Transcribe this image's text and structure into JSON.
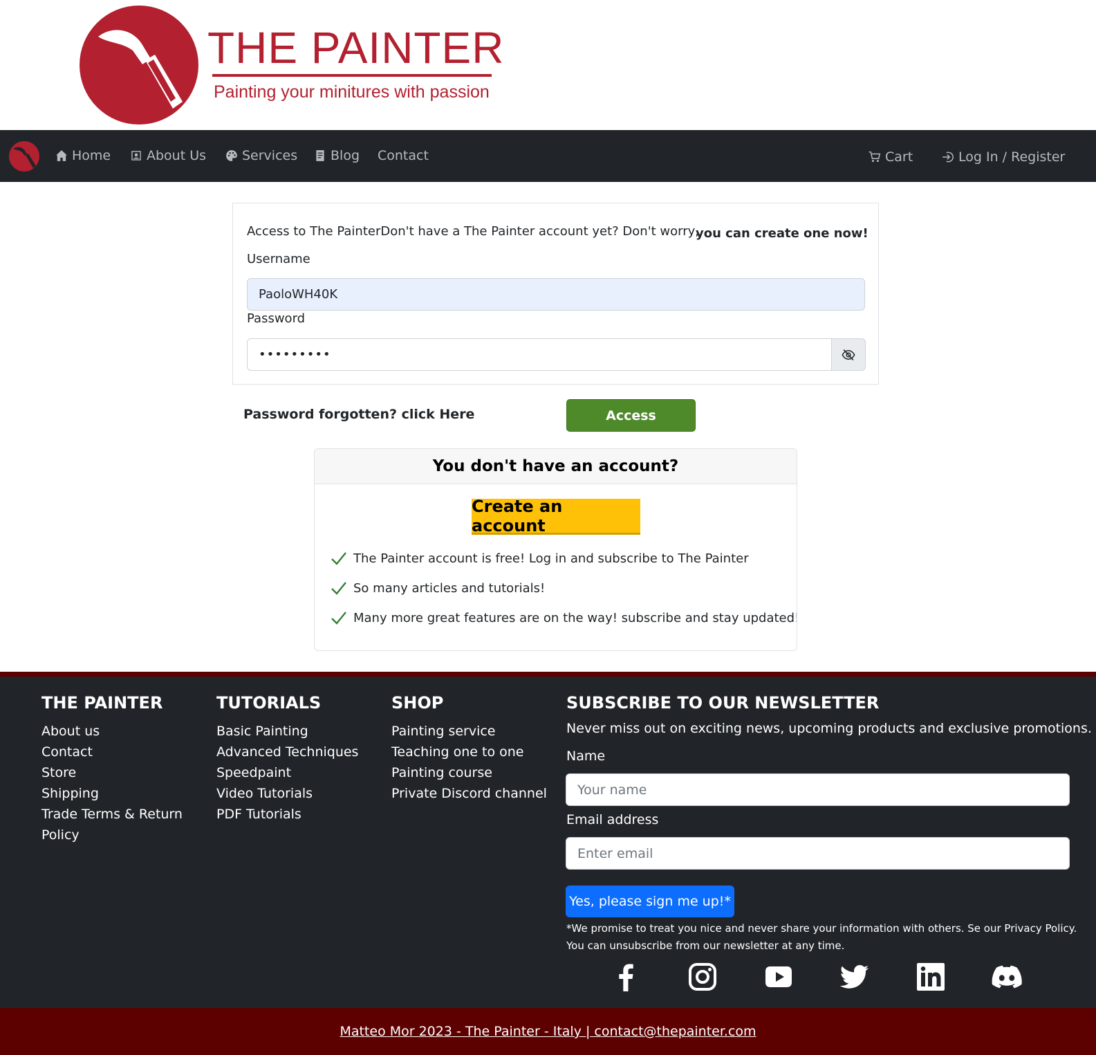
{
  "logo": {
    "title": "THE PAINTER",
    "subtitle": "Painting your minitures with passion",
    "brand_color": "#b3202f"
  },
  "navbar": {
    "items": [
      {
        "label": "Home",
        "icon": "house-icon"
      },
      {
        "label": "About Us",
        "icon": "person-badge-icon"
      },
      {
        "label": "Services",
        "icon": "palette-icon"
      },
      {
        "label": "Blog",
        "icon": "document-icon"
      },
      {
        "label": "Contact",
        "icon": ""
      }
    ],
    "cart_label": "Cart",
    "login_label": "Log In / Register"
  },
  "login": {
    "intro": "Access to The PainterDon't have a The Painter account yet? Don't worry,",
    "create_link": "you can create one now!",
    "username_label": "Username",
    "username_value": "PaoloWH40K",
    "password_label": "Password",
    "password_value": "•••••••••",
    "forgot_text": "Password forgotten? click Here",
    "access_label": "Access"
  },
  "no_account": {
    "title": "You don't have an account?",
    "create_label": "Create an account",
    "features": [
      "The Painter account is free! Log in and subscribe to The Painter",
      "So many articles and tutorials!",
      "Many more great features are on the way! subscribe and stay updated!"
    ]
  },
  "footer": {
    "col1": {
      "title": "THE PAINTER",
      "links": [
        "About us",
        "Contact",
        "Store",
        "Shipping",
        "Trade Terms & Return",
        "Policy"
      ]
    },
    "col2": {
      "title": "TUTORIALS",
      "links": [
        "Basic Painting",
        "Advanced Techniques",
        "Speedpaint",
        "Video Tutorials",
        "PDF Tutorials"
      ]
    },
    "col3": {
      "title": "SHOP",
      "links": [
        "Painting service",
        "Teaching one to one",
        "Painting course",
        "Private Discord channel"
      ]
    },
    "newsletter": {
      "title": "SUBSCRIBE TO OUR NEWSLETTER",
      "description": "Never miss out on exciting news, upcoming products and exclusive promotions.",
      "name_label": "Name",
      "name_placeholder": "Your name",
      "email_label": "Email address",
      "email_placeholder": "Enter email",
      "submit_label": "Yes, please sign me up!*",
      "disclaimer": "*We promise to treat you nice and never share your information with others. Se our Privacy Policy. You can unsubscribe from our newsletter at any time."
    },
    "social": [
      "facebook-icon",
      "instagram-icon",
      "youtube-icon",
      "twitter-icon",
      "linkedin-icon",
      "discord-icon"
    ],
    "copyright": "Matteo Mor 2023 - The Painter - Italy | contact@thepainter.com"
  },
  "colors": {
    "navbar_bg": "#212529",
    "access_green": "#4f8a2a",
    "create_yellow": "#ffc107",
    "subscribe_blue": "#0d6efd",
    "footer_bar": "#5c0000"
  }
}
